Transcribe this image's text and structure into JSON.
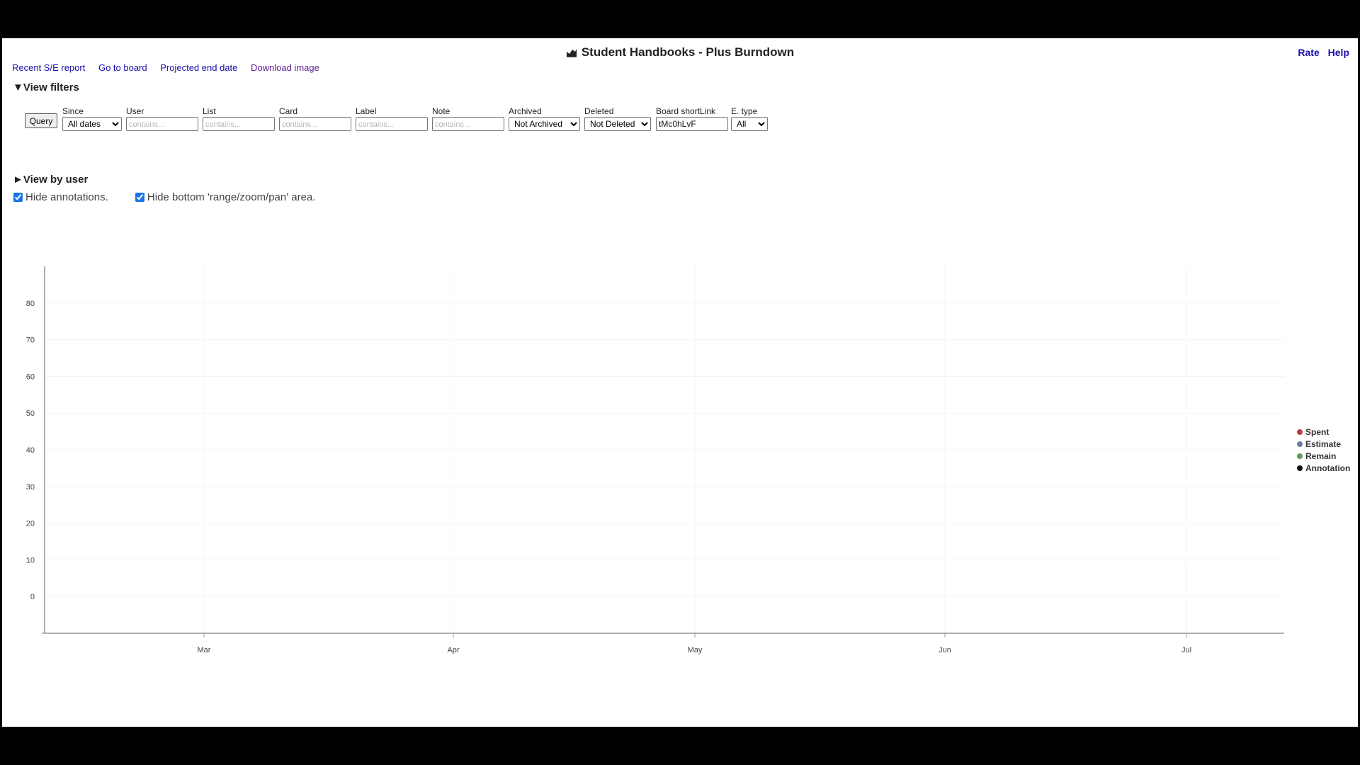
{
  "title": "Student Handbooks - Plus Burndown",
  "top_links": [
    "Rate",
    "Help"
  ],
  "nav_links": [
    "Recent S/E report",
    "Go to board",
    "Projected end date",
    "Download image"
  ],
  "view_filters_label": "View filters",
  "view_by_user_label": "View by user",
  "filters": {
    "query_label": "Query",
    "since": {
      "label": "Since",
      "value": "All dates"
    },
    "user": {
      "label": "User",
      "placeholder": "contains..."
    },
    "list": {
      "label": "List",
      "placeholder": "contains..."
    },
    "card": {
      "label": "Card",
      "placeholder": "contains..."
    },
    "label": {
      "label": "Label",
      "placeholder": "contains..."
    },
    "note": {
      "label": "Note",
      "placeholder": "contains..."
    },
    "archived": {
      "label": "Archived",
      "value": "Not Archived"
    },
    "deleted": {
      "label": "Deleted",
      "value": "Not Deleted"
    },
    "board_shortlink": {
      "label": "Board shortLink",
      "value": "tMc0hLvF"
    },
    "e_type": {
      "label": "E. type",
      "value": "All"
    }
  },
  "options": {
    "hide_annotations": {
      "label": "Hide annotations.",
      "checked": true
    },
    "hide_range": {
      "label": "Hide bottom 'range/zoom/pan' area.",
      "checked": true
    }
  },
  "colors": {
    "link": "#1a0dab",
    "visited": "#5a1d8c",
    "checkbox": "#1a73e8"
  },
  "chart_data": {
    "type": "line",
    "title": "",
    "xlabel": "",
    "ylabel": "",
    "x_ticks": [
      "Mar",
      "Apr",
      "May",
      "Jun",
      "Jul"
    ],
    "y_ticks": [
      0,
      10,
      20,
      30,
      40,
      50,
      60,
      70,
      80
    ],
    "ylim": [
      -10,
      90
    ],
    "grid": true,
    "legend_position": "right",
    "series": [
      {
        "name": "Spent",
        "color": "#c0394b",
        "values": []
      },
      {
        "name": "Estimate",
        "color": "#6b7b9c",
        "values": []
      },
      {
        "name": "Remain",
        "color": "#5aa05a",
        "values": []
      },
      {
        "name": "Annotation",
        "color": "#111111",
        "values": []
      }
    ]
  }
}
